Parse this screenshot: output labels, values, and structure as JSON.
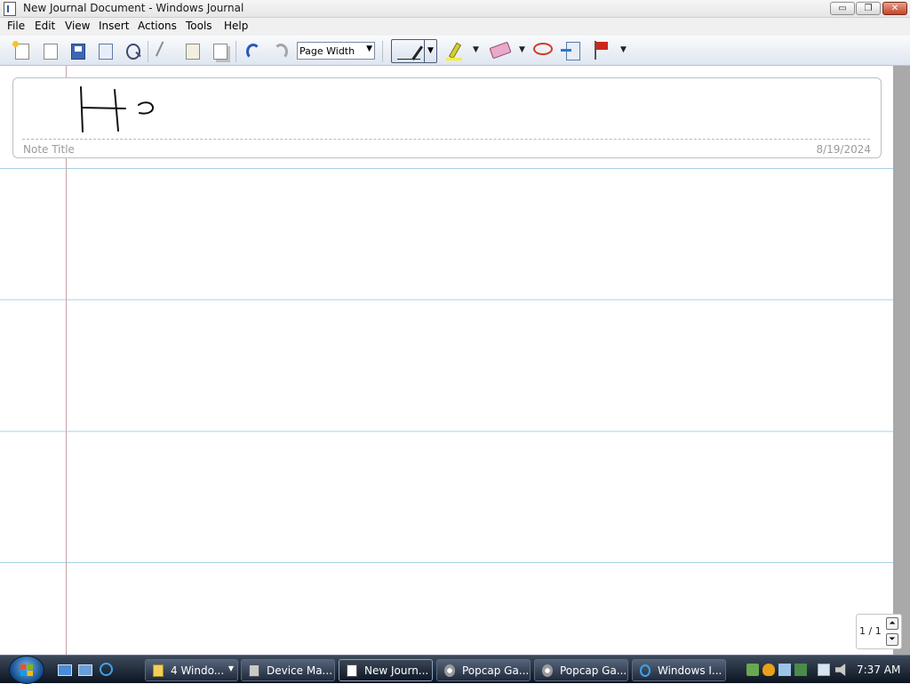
{
  "window": {
    "title": "New Journal Document - Windows Journal",
    "controls": {
      "minimize": "▭",
      "maximize": "❐",
      "close": "✕"
    }
  },
  "menu": [
    "File",
    "Edit",
    "View",
    "Insert",
    "Actions",
    "Tools",
    "Help"
  ],
  "toolbar": {
    "zoom_value": "Page Width",
    "icons": [
      "new-note-icon",
      "new-from-template-icon",
      "save-icon",
      "send-mail-icon",
      "find-icon",
      "cut-icon",
      "paste-icon",
      "copy-icon",
      "undo-icon",
      "redo-icon",
      "pen-icon",
      "highlighter-icon",
      "eraser-icon",
      "lasso-icon",
      "insert-space-icon",
      "flag-icon"
    ],
    "colors": {
      "pen": "#222222",
      "highlighter": "#f4ee3c",
      "eraser": "#e9a9c8",
      "lasso": "#d23a2a",
      "flag": "#d0261c"
    }
  },
  "note": {
    "title_placeholder": "Note Title",
    "date": "8/19/2024",
    "handwriting": "Ho"
  },
  "page_nav": {
    "indicator": "1 / 1",
    "up": "⏶",
    "down": "⏷"
  },
  "taskbar": {
    "buttons": [
      {
        "label": "4 Windo...",
        "icon": "folder-icon",
        "active": false
      },
      {
        "label": "Device Ma...",
        "icon": "device-manager-icon",
        "active": false
      },
      {
        "label": "New Journ...",
        "icon": "journal-icon",
        "active": true
      },
      {
        "label": "Popcap Ga...",
        "icon": "popcap-icon",
        "active": false
      },
      {
        "label": "Popcap Ga...",
        "icon": "popcap-icon",
        "active": false
      },
      {
        "label": "Windows I...",
        "icon": "ie-icon",
        "active": false
      }
    ],
    "clock": "7:37 AM"
  },
  "colors": {
    "rule_line": "#a6d0e6",
    "margin_line": "#c8a1a7",
    "scrollbar": "#a9a9a9"
  }
}
